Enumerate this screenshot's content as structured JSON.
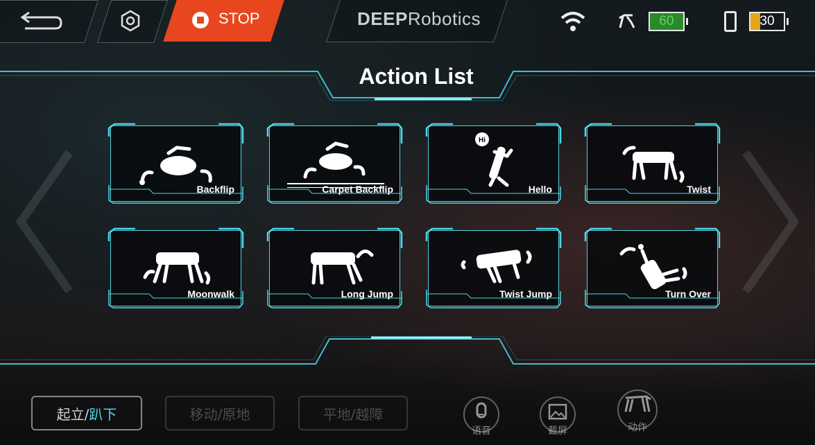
{
  "topbar": {
    "stop_label": "STOP",
    "logo_bold": "DEEP",
    "logo_regular": "Robotics",
    "robot_battery": "60",
    "phone_battery": "30",
    "accent_stop": "#e8461f",
    "robot_battery_color": "#2a8a2a",
    "phone_battery_color": "#e8a417"
  },
  "title": "Action List",
  "actions": [
    {
      "label": "Backflip",
      "icon": "backflip-icon"
    },
    {
      "label": "Carpet Backflip",
      "icon": "carpet-backflip-icon"
    },
    {
      "label": "Hello",
      "icon": "hello-icon",
      "bubble": "Hi"
    },
    {
      "label": "Twist",
      "icon": "twist-icon"
    },
    {
      "label": "Moonwalk",
      "icon": "moonwalk-icon"
    },
    {
      "label": "Long Jump",
      "icon": "long-jump-icon"
    },
    {
      "label": "Twist Jump",
      "icon": "twist-jump-icon"
    },
    {
      "label": "Turn Over",
      "icon": "turn-over-icon"
    }
  ],
  "bottom": {
    "stand_label": "起立/",
    "lie_label": "趴下",
    "move_label": "移动/原地",
    "terrain_label": "平地/越障",
    "voice_label": "语音",
    "screenshot_label": "截屏",
    "action_label": "动作",
    "accent": "#4fd6e6"
  }
}
